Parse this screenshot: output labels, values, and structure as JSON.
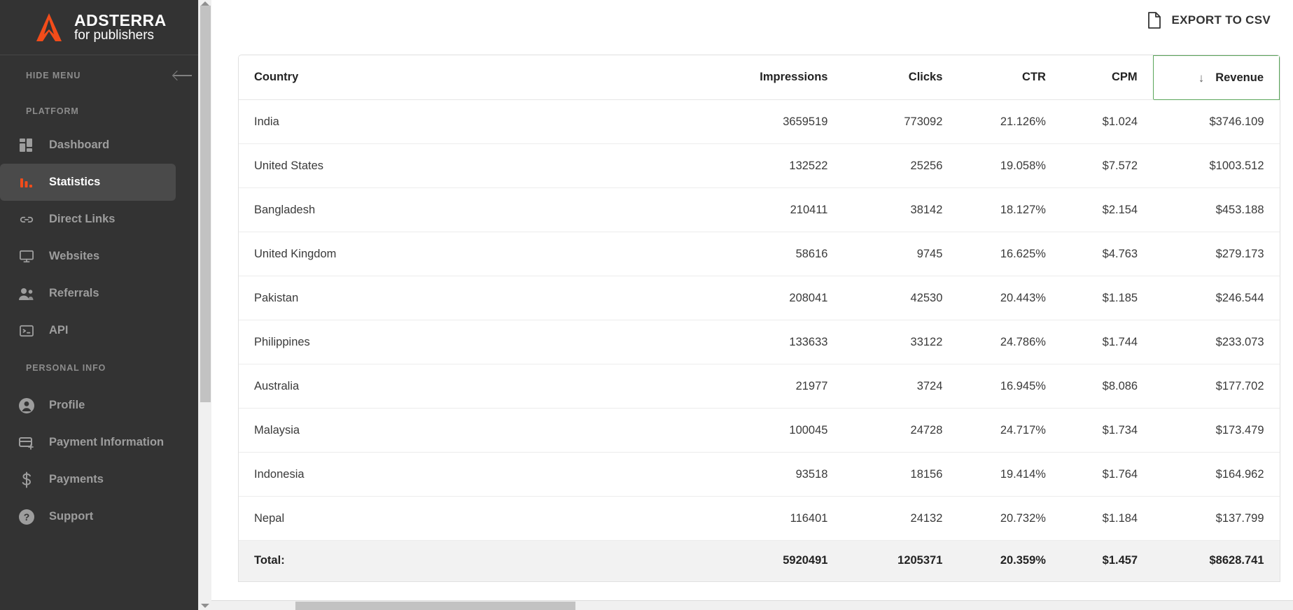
{
  "brand": {
    "name": "ADSTERRA",
    "tagline": "for publishers",
    "logo_color": "#f24c1a"
  },
  "sidebar": {
    "hide_menu_label": "HIDE MENU",
    "sections": [
      {
        "label": "PLATFORM"
      },
      {
        "label": "PERSONAL INFO"
      }
    ],
    "platform_items": [
      {
        "label": "Dashboard",
        "icon": "dashboard-icon",
        "active": false
      },
      {
        "label": "Statistics",
        "icon": "statistics-icon",
        "active": true
      },
      {
        "label": "Direct Links",
        "icon": "link-icon",
        "active": false
      },
      {
        "label": "Websites",
        "icon": "monitor-icon",
        "active": false
      },
      {
        "label": "Referrals",
        "icon": "people-icon",
        "active": false
      },
      {
        "label": "API",
        "icon": "terminal-icon",
        "active": false
      }
    ],
    "personal_items": [
      {
        "label": "Profile",
        "icon": "person-circle-icon",
        "active": false
      },
      {
        "label": "Payment Information",
        "icon": "card-plus-icon",
        "active": false
      },
      {
        "label": "Payments",
        "icon": "dollar-icon",
        "active": false
      },
      {
        "label": "Support",
        "icon": "help-circle-icon",
        "active": false
      }
    ]
  },
  "toolbar": {
    "export_label": "EXPORT TO CSV",
    "export_icon": "file-icon"
  },
  "table": {
    "sorted_column": "Revenue",
    "sort_direction": "desc",
    "sort_arrow": "↓",
    "sort_border_color": "#5aa55a",
    "columns": [
      "Country",
      "Impressions",
      "Clicks",
      "CTR",
      "CPM",
      "Revenue"
    ],
    "rows": [
      {
        "country": "India",
        "impressions": "3659519",
        "clicks": "773092",
        "ctr": "21.126%",
        "cpm": "$1.024",
        "revenue": "$3746.109"
      },
      {
        "country": "United States",
        "impressions": "132522",
        "clicks": "25256",
        "ctr": "19.058%",
        "cpm": "$7.572",
        "revenue": "$1003.512"
      },
      {
        "country": "Bangladesh",
        "impressions": "210411",
        "clicks": "38142",
        "ctr": "18.127%",
        "cpm": "$2.154",
        "revenue": "$453.188"
      },
      {
        "country": "United Kingdom",
        "impressions": "58616",
        "clicks": "9745",
        "ctr": "16.625%",
        "cpm": "$4.763",
        "revenue": "$279.173"
      },
      {
        "country": "Pakistan",
        "impressions": "208041",
        "clicks": "42530",
        "ctr": "20.443%",
        "cpm": "$1.185",
        "revenue": "$246.544"
      },
      {
        "country": "Philippines",
        "impressions": "133633",
        "clicks": "33122",
        "ctr": "24.786%",
        "cpm": "$1.744",
        "revenue": "$233.073"
      },
      {
        "country": "Australia",
        "impressions": "21977",
        "clicks": "3724",
        "ctr": "16.945%",
        "cpm": "$8.086",
        "revenue": "$177.702"
      },
      {
        "country": "Malaysia",
        "impressions": "100045",
        "clicks": "24728",
        "ctr": "24.717%",
        "cpm": "$1.734",
        "revenue": "$173.479"
      },
      {
        "country": "Indonesia",
        "impressions": "93518",
        "clicks": "18156",
        "ctr": "19.414%",
        "cpm": "$1.764",
        "revenue": "$164.962"
      },
      {
        "country": "Nepal",
        "impressions": "116401",
        "clicks": "24132",
        "ctr": "20.732%",
        "cpm": "$1.184",
        "revenue": "$137.799"
      }
    ],
    "total": {
      "label": "Total:",
      "impressions": "5920491",
      "clicks": "1205371",
      "ctr": "20.359%",
      "cpm": "$1.457",
      "revenue": "$8628.741"
    }
  }
}
